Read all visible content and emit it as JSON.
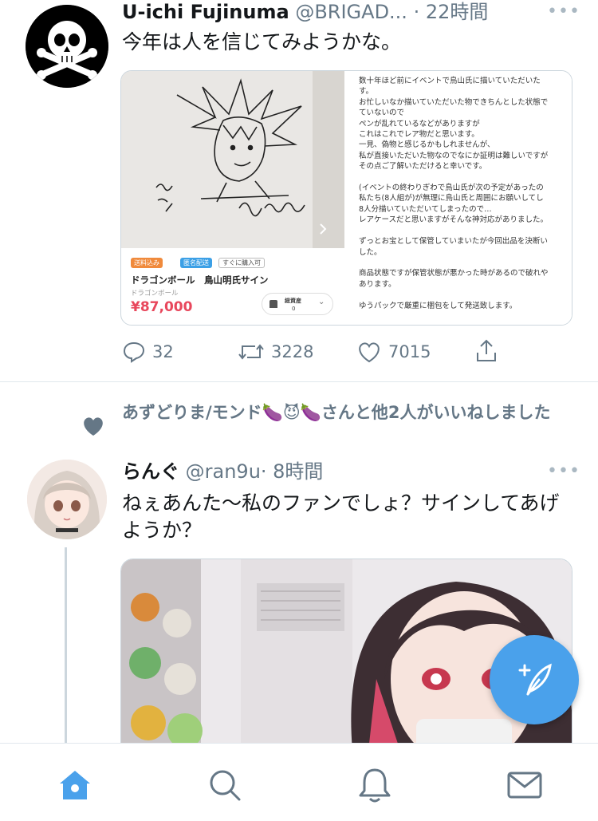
{
  "colors": {
    "accent": "#4aa1eb",
    "secondary_text": "#657786",
    "divider": "#e1e8ed",
    "price_red": "#e8475c"
  },
  "tweet1": {
    "display_name": "U-ichi Fujinuma",
    "handle": "@BRIGAD...",
    "time": "· 22時間",
    "more": "•••",
    "text": "今年は人を信じてみようかな。",
    "card": {
      "tags": [
        "送料込み",
        "匿名配送",
        "すぐに購入可"
      ],
      "product_title": "ドラゴンボール　鳥山明氏サイン",
      "product_category": "ドラゴンボール",
      "price": "¥87,000",
      "assets_label": "総資産",
      "assets_value": "0",
      "description": [
        "数十年ほど前にイベントで鳥山氏に描いていただいた",
        "す。",
        "お忙しいなか描いていただいた物できちんとした状態で",
        "ていないので",
        "ペンが乱れているなどがありますが",
        "これはこれでレア物だと思います。",
        "一見、偽物と感じるかもしれませんが、",
        "私が直接いただいた物なのでなにか証明は難しいですが",
        "その点ご了解いただけると幸いです。",
        "",
        "(イベントの終わりぎわで鳥山氏が次の予定があったの",
        "私たち(8人組が)が無理に鳥山氏と周囲にお願いしてし",
        "8人分描いていただいてしまったので…",
        "レアケースだと思いますがそんな神対応がありました。",
        "",
        "ずっとお宝として保管していまいたが今回出品を決断い",
        "した。",
        "",
        "商品状態ですが保管状態が悪かった時があるので破れや",
        "あります。",
        "",
        "ゆうパックで厳重に梱包をして発送致します。"
      ]
    },
    "replies": "32",
    "retweets": "3228",
    "likes": "7015"
  },
  "tweet2": {
    "liked_by": "あずどりま/モンド🍆😈🍆さんと他2人がいいねしました",
    "display_name": "らんぐ",
    "handle": "@ran9u",
    "time": "· 8時間",
    "more": "•••",
    "text": "ねぇあんた〜私のファンでしょ？サインしてあげようか？"
  },
  "nav": {
    "items": [
      "home-icon",
      "search-icon",
      "notifications-icon",
      "messages-icon"
    ]
  }
}
